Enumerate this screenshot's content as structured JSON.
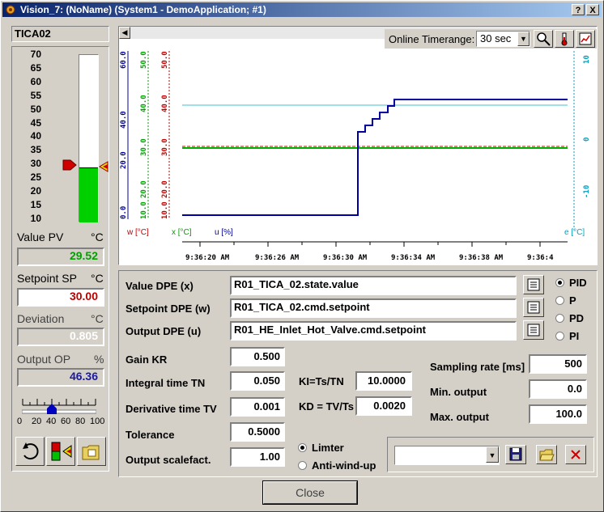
{
  "window": {
    "title": "Vision_7: (NoName) (System1 - DemoApplication; #1)",
    "help_label": "?",
    "close_label": "X"
  },
  "faceplate": {
    "tag": "TICA02",
    "scale": [
      "70",
      "65",
      "60",
      "55",
      "50",
      "45",
      "40",
      "35",
      "30",
      "25",
      "20",
      "15",
      "10"
    ],
    "bar_level_c": 29.52,
    "setpoint_c": 30.0,
    "value_pv": {
      "label": "Value PV",
      "unit": "°C",
      "value": "29.52",
      "color": "#00a000"
    },
    "setpoint_sp": {
      "label": "Setpoint SP",
      "unit": "°C",
      "value": "30.00",
      "color": "#c00000"
    },
    "deviation": {
      "label": "Deviation",
      "unit": "°C",
      "value": "0.805",
      "color": "#ffffff"
    },
    "output_op": {
      "label": "Output OP",
      "unit": "%",
      "value": "46.36",
      "color": "#1a1aa0"
    },
    "slider": {
      "labels": [
        "0",
        "20",
        "40",
        "60",
        "80",
        "100"
      ],
      "value": 40
    }
  },
  "trend": {
    "timerange_label": "Online Timerange:",
    "timerange_value": "30 sec",
    "legend": {
      "w": "w [°C]",
      "x": "x [°C]",
      "u": "u [%]",
      "e": "e [°C]"
    },
    "time_labels": [
      "9:36:20 AM",
      "9:36:26 AM",
      "9:36:30 AM",
      "9:36:34 AM",
      "9:36:38 AM",
      "9:36:4"
    ],
    "axis_u": [
      "60.0",
      "40.0",
      "20.0",
      "0.0"
    ],
    "axis_x": [
      "50.0",
      "40.0",
      "30.0",
      "20.0",
      "10.0"
    ],
    "axis_w": [
      "50.0",
      "40.0",
      "30.0",
      "20.0",
      "10.0"
    ],
    "axis_e": [
      "10",
      "0",
      "-10"
    ]
  },
  "config": {
    "value_dpe": {
      "label": "Value DPE (x)",
      "value": "R01_TICA_02.state.value"
    },
    "setpoint_dpe": {
      "label": "Setpoint DPE (w)",
      "value": "R01_TICA_02.cmd.setpoint"
    },
    "output_dpe": {
      "label": "Output DPE (u)",
      "value": "R01_HE_Inlet_Hot_Valve.cmd.setpoint"
    },
    "modes": [
      "PID",
      "P",
      "PD",
      "PI"
    ],
    "selected_mode": "PID",
    "gain_kr": {
      "label": "Gain KR",
      "value": "0.500"
    },
    "integral_tn": {
      "label": "Integral time TN",
      "value": "0.050"
    },
    "derivative_tv": {
      "label": "Derivative time TV",
      "value": "0.001"
    },
    "tolerance": {
      "label": "Tolerance",
      "value": "0.5000"
    },
    "output_scale": {
      "label": "Output scalefact.",
      "value": "1.00"
    },
    "ki": {
      "label": "KI=Ts/TN",
      "value": "10.0000"
    },
    "kd": {
      "label": "KD = TV/Ts",
      "value": "0.0020"
    },
    "sampling_rate": {
      "label": "Sampling rate [ms]",
      "value": "500"
    },
    "min_output": {
      "label": "Min. output",
      "value": "0.0"
    },
    "max_output": {
      "label": "Max. output",
      "value": "100.0"
    },
    "limiter_label": "Limter",
    "antiwindup_label": "Anti-wind-up"
  },
  "footer": {
    "close_label": "Close"
  }
}
